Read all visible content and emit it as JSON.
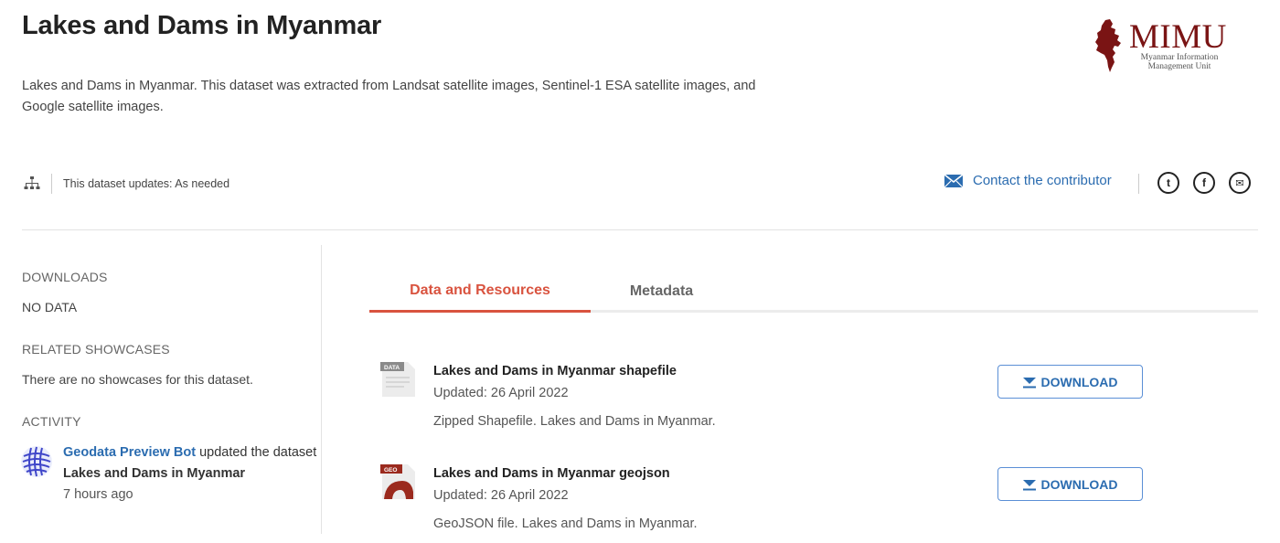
{
  "dataset": {
    "title": "Lakes and Dams in Myanmar",
    "description": "Lakes and Dams in Myanmar. This dataset was extracted from Landsat satellite images, Sentinel-1 ESA satellite images, and Google satellite images.",
    "update_frequency": "This dataset updates: As needed"
  },
  "org": {
    "logo_text": "MIMU",
    "logo_subtitle": "Myanmar Information Management Unit"
  },
  "contact": {
    "label": "Contact the contributor"
  },
  "social": {
    "twitter_glyph": "t",
    "facebook_glyph": "f",
    "email_glyph": "✉"
  },
  "sidebar": {
    "downloads_heading": "DOWNLOADS",
    "downloads_value": "NO DATA",
    "showcases_heading": "RELATED SHOWCASES",
    "showcases_value": "There are no showcases for this dataset.",
    "activity_heading": "ACTIVITY",
    "activity": {
      "actor": "Geodata Preview Bot",
      "action": " updated the dataset ",
      "dataset": "Lakes and Dams in Myanmar",
      "time": "7 hours ago"
    }
  },
  "tabs": [
    {
      "label": "Data and Resources",
      "active": true
    },
    {
      "label": "Metadata",
      "active": false
    }
  ],
  "resources": [
    {
      "icon_label": "DATA",
      "title": "Lakes and Dams in Myanmar shapefile",
      "updated": "Updated: 26 April 2022",
      "description": "Zipped Shapefile. Lakes and Dams in Myanmar.",
      "download_label": "DOWNLOAD"
    },
    {
      "icon_label": "GEO",
      "title": "Lakes and Dams in Myanmar geojson",
      "updated": "Updated: 26 April 2022",
      "description": "GeoJSON file. Lakes and Dams in Myanmar.",
      "download_label": "DOWNLOAD"
    }
  ],
  "colors": {
    "accent_tab": "#d9533f",
    "link_blue": "#2b6cb0",
    "logo_red": "#7a1414"
  }
}
